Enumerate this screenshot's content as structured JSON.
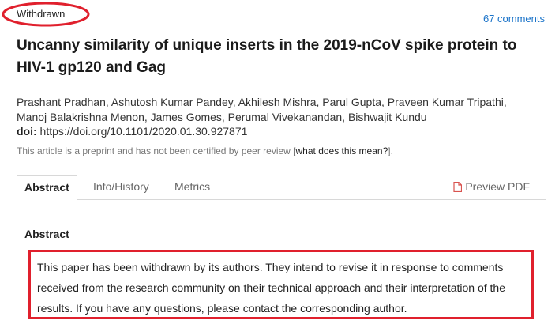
{
  "status": {
    "label": "Withdrawn",
    "highlight_color": "#e0202d"
  },
  "comments": {
    "label": "67 comments"
  },
  "article": {
    "title": "Uncanny similarity of unique inserts in the 2019-nCoV spike protein to HIV-1 gp120 and Gag",
    "authors_line1": "Prashant Pradhan, Ashutosh Kumar Pandey, Akhilesh Mishra, Parul Gupta, Praveen Kumar Tripathi,",
    "authors_line2": "Manoj Balakrishna Menon, James Gomes, Perumal Vivekanandan, Bishwajit Kundu",
    "doi_label": "doi:",
    "doi_value": "https://doi.org/10.1101/2020.01.30.927871",
    "preprint_note_prefix": "This article is a preprint and has not been certified by peer review [",
    "preprint_note_link": "what does this mean?",
    "preprint_note_suffix": "]."
  },
  "tabs": [
    {
      "label": "Abstract",
      "active": true
    },
    {
      "label": "Info/History",
      "active": false
    },
    {
      "label": "Metrics",
      "active": false
    }
  ],
  "preview_pdf": {
    "label": "Preview PDF",
    "icon": "pdf-file-icon",
    "color": "#d9534f"
  },
  "abstract": {
    "heading": "Abstract",
    "text": "This paper has been withdrawn by its authors. They intend to revise it in response to comments received from the research community on their technical approach and their interpretation of the results. If you have any questions, please contact the corresponding author."
  }
}
